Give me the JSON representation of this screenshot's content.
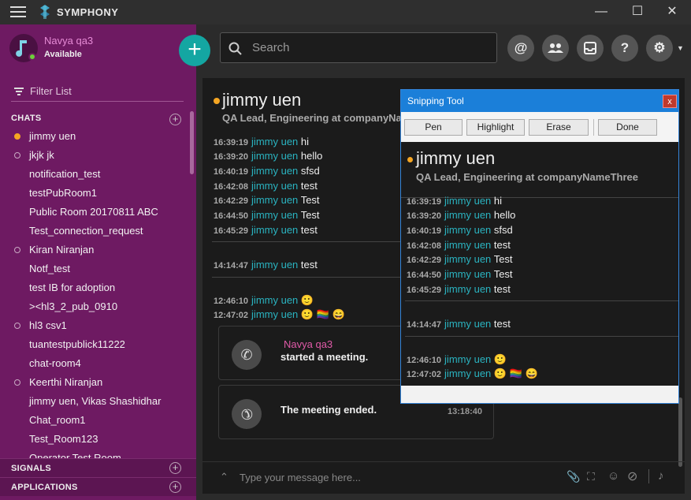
{
  "app": {
    "name": "SYMPHONY"
  },
  "user": {
    "name": "Navya qa3",
    "status": "Available"
  },
  "filter": {
    "placeholder": "Filter List"
  },
  "sections": {
    "chats": "CHATS",
    "signals": "SIGNALS",
    "applications": "APPLICATIONS"
  },
  "chats": [
    {
      "label": "jimmy uen",
      "indicator": "away"
    },
    {
      "label": "jkjk jk",
      "indicator": "offline"
    },
    {
      "label": "notification_test",
      "indicator": "none"
    },
    {
      "label": "testPubRoom1",
      "indicator": "none"
    },
    {
      "label": "Public Room 20170811 ABC",
      "indicator": "none"
    },
    {
      "label": "Test_connection_request",
      "indicator": "none"
    },
    {
      "label": "Kiran Niranjan",
      "indicator": "offline"
    },
    {
      "label": "Notf_test",
      "indicator": "none"
    },
    {
      "label": "test IB for adoption",
      "indicator": "none"
    },
    {
      "label": "><hl3_2_pub_0910",
      "indicator": "none"
    },
    {
      "label": "hl3 csv1",
      "indicator": "offline"
    },
    {
      "label": "tuantestpublick11222",
      "indicator": "none"
    },
    {
      "label": "chat-room4",
      "indicator": "none"
    },
    {
      "label": "Keerthi Niranjan",
      "indicator": "offline"
    },
    {
      "label": "jimmy uen, Vikas Shashidhar",
      "indicator": "none"
    },
    {
      "label": "Chat_room1",
      "indicator": "none"
    },
    {
      "label": "Test_Room123",
      "indicator": "none"
    },
    {
      "label": "Operator Test Room",
      "indicator": "none"
    }
  ],
  "search": {
    "placeholder": "Search"
  },
  "topicons": [
    "@",
    "people",
    "inbox",
    "?",
    "gear"
  ],
  "conversation": {
    "name": "jimmy uen",
    "role": "QA Lead, Engineering at companyNameThree",
    "role_truncated": "QA Lead, Engineering at companyName",
    "messages": [
      {
        "time": "16:39:19",
        "who": "jimmy uen",
        "text": "hi"
      },
      {
        "time": "16:39:20",
        "who": "jimmy uen",
        "text": "hello"
      },
      {
        "time": "16:40:19",
        "who": "jimmy uen",
        "text": "sfsd"
      },
      {
        "time": "16:42:08",
        "who": "jimmy uen",
        "text": "test"
      },
      {
        "time": "16:42:29",
        "who": "jimmy uen",
        "text": "Test"
      },
      {
        "time": "16:44:50",
        "who": "jimmy uen",
        "text": "Test"
      },
      {
        "time": "16:45:29",
        "who": "jimmy uen",
        "text": "test"
      },
      {
        "time": "14:14:47",
        "who": "jimmy uen",
        "text": "test"
      },
      {
        "time": "12:46:10",
        "who": "jimmy uen",
        "text": "🙂"
      },
      {
        "time": "12:47:02",
        "who": "jimmy uen",
        "text": "🙂 🏳️‍🌈 😄"
      }
    ],
    "meeting_start": {
      "who": "Navya qa3",
      "text": "started a meeting."
    },
    "meeting_end": {
      "text": "The meeting ended.",
      "time": "13:18:40"
    }
  },
  "input": {
    "placeholder": "Type your message here..."
  },
  "snipping": {
    "title": "Snipping Tool",
    "close": "x",
    "pen": "Pen",
    "highlight": "Highlight",
    "erase": "Erase",
    "done": "Done"
  },
  "colors": {
    "sidebar": "#6e1a62",
    "accent": "#14a6a2",
    "mention": "#2ab3c0"
  }
}
